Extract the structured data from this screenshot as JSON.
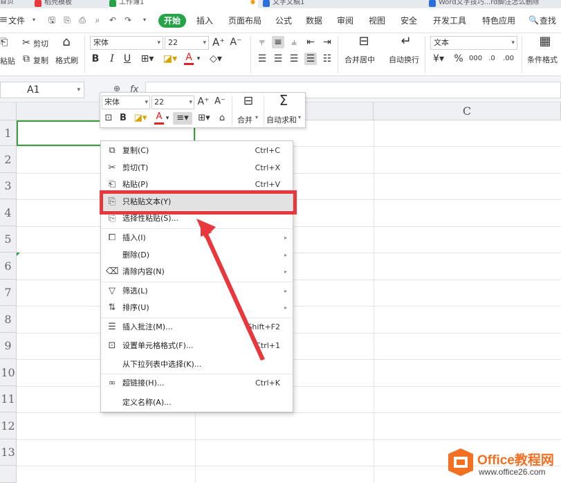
{
  "tabs": [
    {
      "label": "首页",
      "color": "#2a6fdb"
    },
    {
      "label": "稻壳模板",
      "color": "#e8383d"
    },
    {
      "label": "工作簿1",
      "color": "#26a346"
    },
    {
      "label": "文字文稿1",
      "color": "#2a6fdb"
    },
    {
      "label": "Word文字技巧...rd脚注怎么删除",
      "color": "#2a6fdb"
    }
  ],
  "menubar": {
    "file": "文件",
    "items": [
      "开始",
      "插入",
      "页面布局",
      "公式",
      "数据",
      "审阅",
      "视图",
      "安全",
      "开发工具",
      "特色应用"
    ],
    "search": "查找"
  },
  "ribbon": {
    "cut": "剪切",
    "copy": "复制",
    "paste": "粘贴",
    "format_painter": "格式刷",
    "font_name": "宋体",
    "font_size": "22",
    "bold": "B",
    "italic": "I",
    "underline": "U",
    "merge_center": "合并居中",
    "wrap_text": "自动换行",
    "number_format": "文本",
    "cond_format": "条件格式"
  },
  "formula_bar": {
    "name_box": "A1",
    "fx": "fx"
  },
  "grid": {
    "columns": [
      "",
      "C"
    ],
    "rows": [
      "1",
      "2",
      "3",
      "4",
      "5",
      "6",
      "7",
      "8",
      "9",
      "10",
      "11",
      "12",
      "13"
    ]
  },
  "mini_toolbar": {
    "font_name": "宋体",
    "font_size": "22",
    "bold": "B",
    "merge": "合并",
    "autosum": "自动求和"
  },
  "context_menu": {
    "items": [
      {
        "icon": "copy-icon",
        "label": "复制(C)",
        "shortcut": "Ctrl+C"
      },
      {
        "icon": "cut-icon",
        "label": "剪切(T)",
        "shortcut": "Ctrl+X"
      },
      {
        "icon": "paste-icon",
        "label": "粘贴(P)",
        "shortcut": "Ctrl+V"
      },
      {
        "icon": "paste-text-icon",
        "label": "只粘贴文本(Y)",
        "shortcut": ""
      },
      {
        "icon": "paste-special-icon",
        "label": "选择性粘贴(S)...",
        "shortcut": ""
      },
      {
        "icon": "insert-icon",
        "label": "插入(I)",
        "shortcut": ""
      },
      {
        "icon": "",
        "label": "删除(D)",
        "shortcut": ""
      },
      {
        "icon": "eraser-icon",
        "label": "清除内容(N)",
        "shortcut": ""
      },
      {
        "icon": "filter-icon",
        "label": "筛选(L)",
        "shortcut": ""
      },
      {
        "icon": "sort-icon",
        "label": "排序(U)",
        "shortcut": ""
      },
      {
        "icon": "comment-icon",
        "label": "插入批注(M)...",
        "shortcut": "Shift+F2"
      },
      {
        "icon": "format-cells-icon",
        "label": "设置单元格格式(F)...",
        "shortcut": "Ctrl+1"
      },
      {
        "icon": "",
        "label": "从下拉列表中选择(K)...",
        "shortcut": ""
      },
      {
        "icon": "link-icon",
        "label": "超链接(H)...",
        "shortcut": "Ctrl+K"
      },
      {
        "icon": "",
        "label": "定义名称(A)...",
        "shortcut": ""
      }
    ],
    "highlighted_index": 3
  },
  "watermark": {
    "title": "Office教程网",
    "url": "www.office26.com"
  },
  "colors": {
    "accent_green": "#26a346",
    "annotation_red": "#e8383d",
    "watermark_orange": "#f36f21"
  }
}
